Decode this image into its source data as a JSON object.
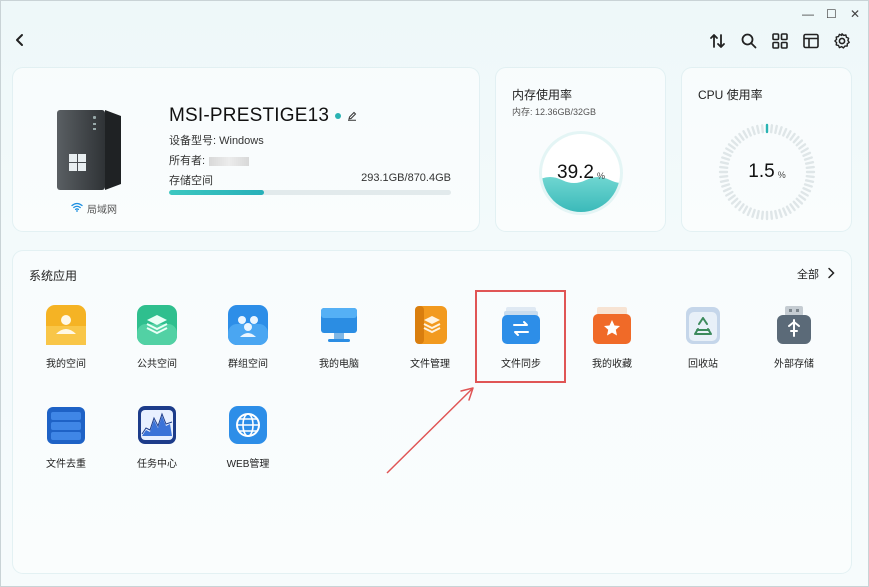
{
  "window_controls": {
    "minimize": "—",
    "maximize": "☐",
    "close": "✕"
  },
  "toolbar": {
    "back": "back",
    "icons": [
      "sort-icon",
      "search-icon",
      "grid-icon",
      "window-icon",
      "gear-icon"
    ]
  },
  "device": {
    "name": "MSI-PRESTIGE13",
    "model_label": "设备型号: Windows",
    "owner_label": "所有者:",
    "storage_label": "存储空间",
    "storage_value": "293.1GB/870.4GB",
    "storage_used_fraction": 0.337,
    "network": "局域网"
  },
  "memory": {
    "title": "内存使用率",
    "sub": "内存: 12.36GB/32GB",
    "value": "39.2",
    "unit": "%"
  },
  "cpu": {
    "title": "CPU 使用率",
    "value": "1.5",
    "unit": "%"
  },
  "apps": {
    "section_title": "系统应用",
    "all_label": "全部",
    "items": [
      {
        "label": "我的空间"
      },
      {
        "label": "公共空间"
      },
      {
        "label": "群组空间"
      },
      {
        "label": "我的电脑"
      },
      {
        "label": "文件管理"
      },
      {
        "label": "文件同步"
      },
      {
        "label": "我的收藏"
      },
      {
        "label": "回收站"
      },
      {
        "label": "外部存储"
      },
      {
        "label": "文件去重"
      },
      {
        "label": "任务中心"
      },
      {
        "label": "WEB管理"
      }
    ]
  },
  "colors": {
    "accent": "#2ab3b3",
    "highlight": "#e05555"
  }
}
